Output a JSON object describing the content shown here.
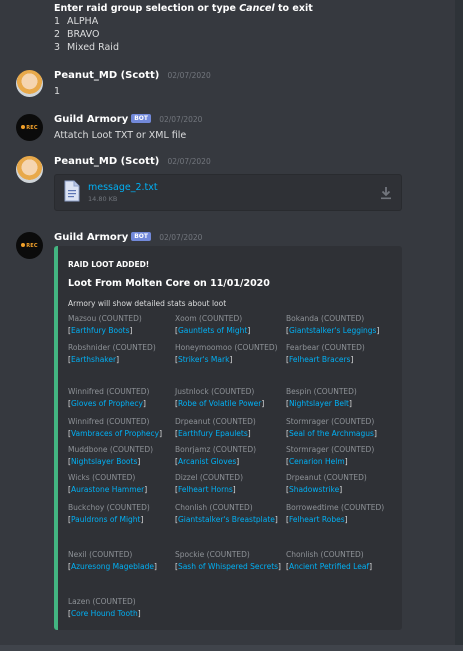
{
  "top": {
    "prompt_pre": "Enter raid group selection or type ",
    "prompt_cancel": "Cancel",
    "prompt_post": " to exit",
    "options": [
      {
        "num": "1",
        "label": "ALPHA"
      },
      {
        "num": "2",
        "label": "BRAVO"
      },
      {
        "num": "3",
        "label": "Mixed Raid"
      }
    ]
  },
  "messages": [
    {
      "user": "Peanut_MD (Scott)",
      "timestamp": "02/07/2020",
      "text": "1"
    },
    {
      "user": "Guild Armory",
      "badge": "BOT",
      "timestamp": "02/07/2020",
      "text": "Attatch Loot TXT or XML file"
    },
    {
      "user": "Peanut_MD (Scott)",
      "timestamp": "02/07/2020",
      "file_name": "message_2.txt",
      "file_size": "14.80 KB"
    },
    {
      "user": "Guild Armory",
      "badge": "BOT",
      "timestamp": "02/07/2020"
    }
  ],
  "avatar_bot_label": "REC",
  "embed": {
    "accent_color": "#43b581",
    "author": "RAID LOOT ADDED!",
    "title": "Loot From Molten Core on 11/01/2020",
    "description": "Armory will show detailed stats about loot",
    "fields": [
      {
        "name": "Mazsou (COUNTED)",
        "item": "Earthfury Boots"
      },
      {
        "name": "Xoom (COUNTED)",
        "item": "Gauntlets of Might"
      },
      {
        "name": "Bokanda (COUNTED)",
        "item": "Giantstalker's Leggings"
      },
      {
        "name": "Robshnider (COUNTED)",
        "item": "Earthshaker"
      },
      {
        "name": "Honeymoomoo (COUNTED)",
        "item": "Striker's Mark"
      },
      {
        "name": "Fearbear (COUNTED)",
        "item": "Felheart Bracers"
      },
      {
        "name": "Winnifred (COUNTED)",
        "item": "Gloves of Prophecy"
      },
      {
        "name": "Justnlock (COUNTED)",
        "item": "Robe of Volatile Power"
      },
      {
        "name": "Bespin (COUNTED)",
        "item": "Nightslayer Belt"
      },
      {
        "name": "Winnifred (COUNTED)",
        "item": "Vambraces of Prophecy"
      },
      {
        "name": "Drpeanut (COUNTED)",
        "item": "Earthfury Epaulets"
      },
      {
        "name": "Stormrager (COUNTED)",
        "item": "Seal of the Archmagus"
      },
      {
        "name": "Muddbone (COUNTED)",
        "item": "Nightslayer Boots"
      },
      {
        "name": "Bonrjamz (COUNTED)",
        "item": "Arcanist Gloves"
      },
      {
        "name": "Stormrager (COUNTED)",
        "item": "Cenarion Helm"
      },
      {
        "name": "Wicks (COUNTED)",
        "item": "Aurastone Hammer"
      },
      {
        "name": "Dizzel (COUNTED)",
        "item": "Felheart Horns"
      },
      {
        "name": "Drpeanut (COUNTED)",
        "item": "Shadowstrike"
      },
      {
        "name": "Buckchoy (COUNTED)",
        "item": "Pauldrons of Might"
      },
      {
        "name": "Chonlish (COUNTED)",
        "item": "Giantstalker's Breastplate"
      },
      {
        "name": "Borrowedtime (COUNTED)",
        "item": "Felheart Robes"
      },
      {
        "name": "Nexil (COUNTED)",
        "item": "Azuresong Mageblade"
      },
      {
        "name": "Spockie (COUNTED)",
        "item": "Sash of Whispered Secrets"
      },
      {
        "name": "Chonlish (COUNTED)",
        "item": "Ancient Petrified Leaf"
      },
      {
        "name": "Lazen (COUNTED)",
        "item": "Core Hound Tooth"
      }
    ]
  }
}
